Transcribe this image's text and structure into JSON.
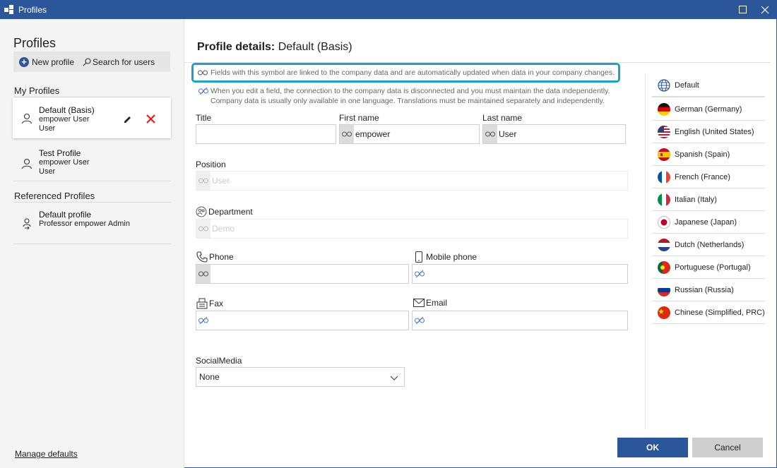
{
  "window": {
    "title": "Profiles",
    "maximize_icon": "maximize-icon",
    "close_icon": "close-icon"
  },
  "sidebar": {
    "title": "Profiles",
    "new_profile": "New profile",
    "search_users": "Search for users",
    "my_profiles_header": "My Profiles",
    "my_profiles": [
      {
        "name": "Default (Basis)",
        "line2": "empower User",
        "line3": "User"
      },
      {
        "name": "Test Profile",
        "line2": "empower User",
        "line3": "User"
      }
    ],
    "referenced_header": "Referenced Profiles",
    "referenced": [
      {
        "name": "Default profile",
        "line2": "Professor empower Admin"
      }
    ],
    "manage_defaults": "Manage defaults"
  },
  "main": {
    "heading_bold": "Profile details:",
    "heading_value": "Default (Basis)",
    "hint_linked": "Fields with this symbol are linked to the company data and are automatically updated when data in your company changes.",
    "hint_unlinked_1": "When you edit a field, the connection to the company data is disconnected and you must maintain the data independently.",
    "hint_unlinked_2": "Company data is usually only available in one language. Translations must be maintained separately and independently.",
    "fields": {
      "title": {
        "label": "Title",
        "value": ""
      },
      "first_name": {
        "label": "First name",
        "value": "empower"
      },
      "last_name": {
        "label": "Last name",
        "value": "User"
      },
      "position": {
        "label": "Position",
        "value": "User"
      },
      "department": {
        "label": "Department",
        "value": "Demo"
      },
      "phone": {
        "label": "Phone",
        "value": ""
      },
      "mobile": {
        "label": "Mobile phone",
        "value": ""
      },
      "fax": {
        "label": "Fax",
        "value": ""
      },
      "email": {
        "label": "Email",
        "value": ""
      },
      "social": {
        "label": "SocialMedia",
        "value": "None"
      }
    }
  },
  "languages": [
    {
      "label": "Default",
      "icon": "globe-icon"
    },
    {
      "label": "German (Germany)",
      "icon": "flag-germany-icon"
    },
    {
      "label": "English (United States)",
      "icon": "flag-usa-icon"
    },
    {
      "label": "Spanish (Spain)",
      "icon": "flag-spain-icon"
    },
    {
      "label": "French (France)",
      "icon": "flag-france-icon"
    },
    {
      "label": "Italian (Italy)",
      "icon": "flag-italy-icon"
    },
    {
      "label": "Japanese (Japan)",
      "icon": "flag-japan-icon"
    },
    {
      "label": "Dutch (Netherlands)",
      "icon": "flag-netherlands-icon"
    },
    {
      "label": "Portuguese (Portugal)",
      "icon": "flag-portugal-icon"
    },
    {
      "label": "Russian (Russia)",
      "icon": "flag-russia-icon"
    },
    {
      "label": "Chinese (Simplified, PRC)",
      "icon": "flag-china-icon"
    }
  ],
  "buttons": {
    "ok": "OK",
    "cancel": "Cancel"
  },
  "colors": {
    "accent": "#2b579a",
    "highlight": "#1aa3c9",
    "delete": "#e0202a"
  }
}
